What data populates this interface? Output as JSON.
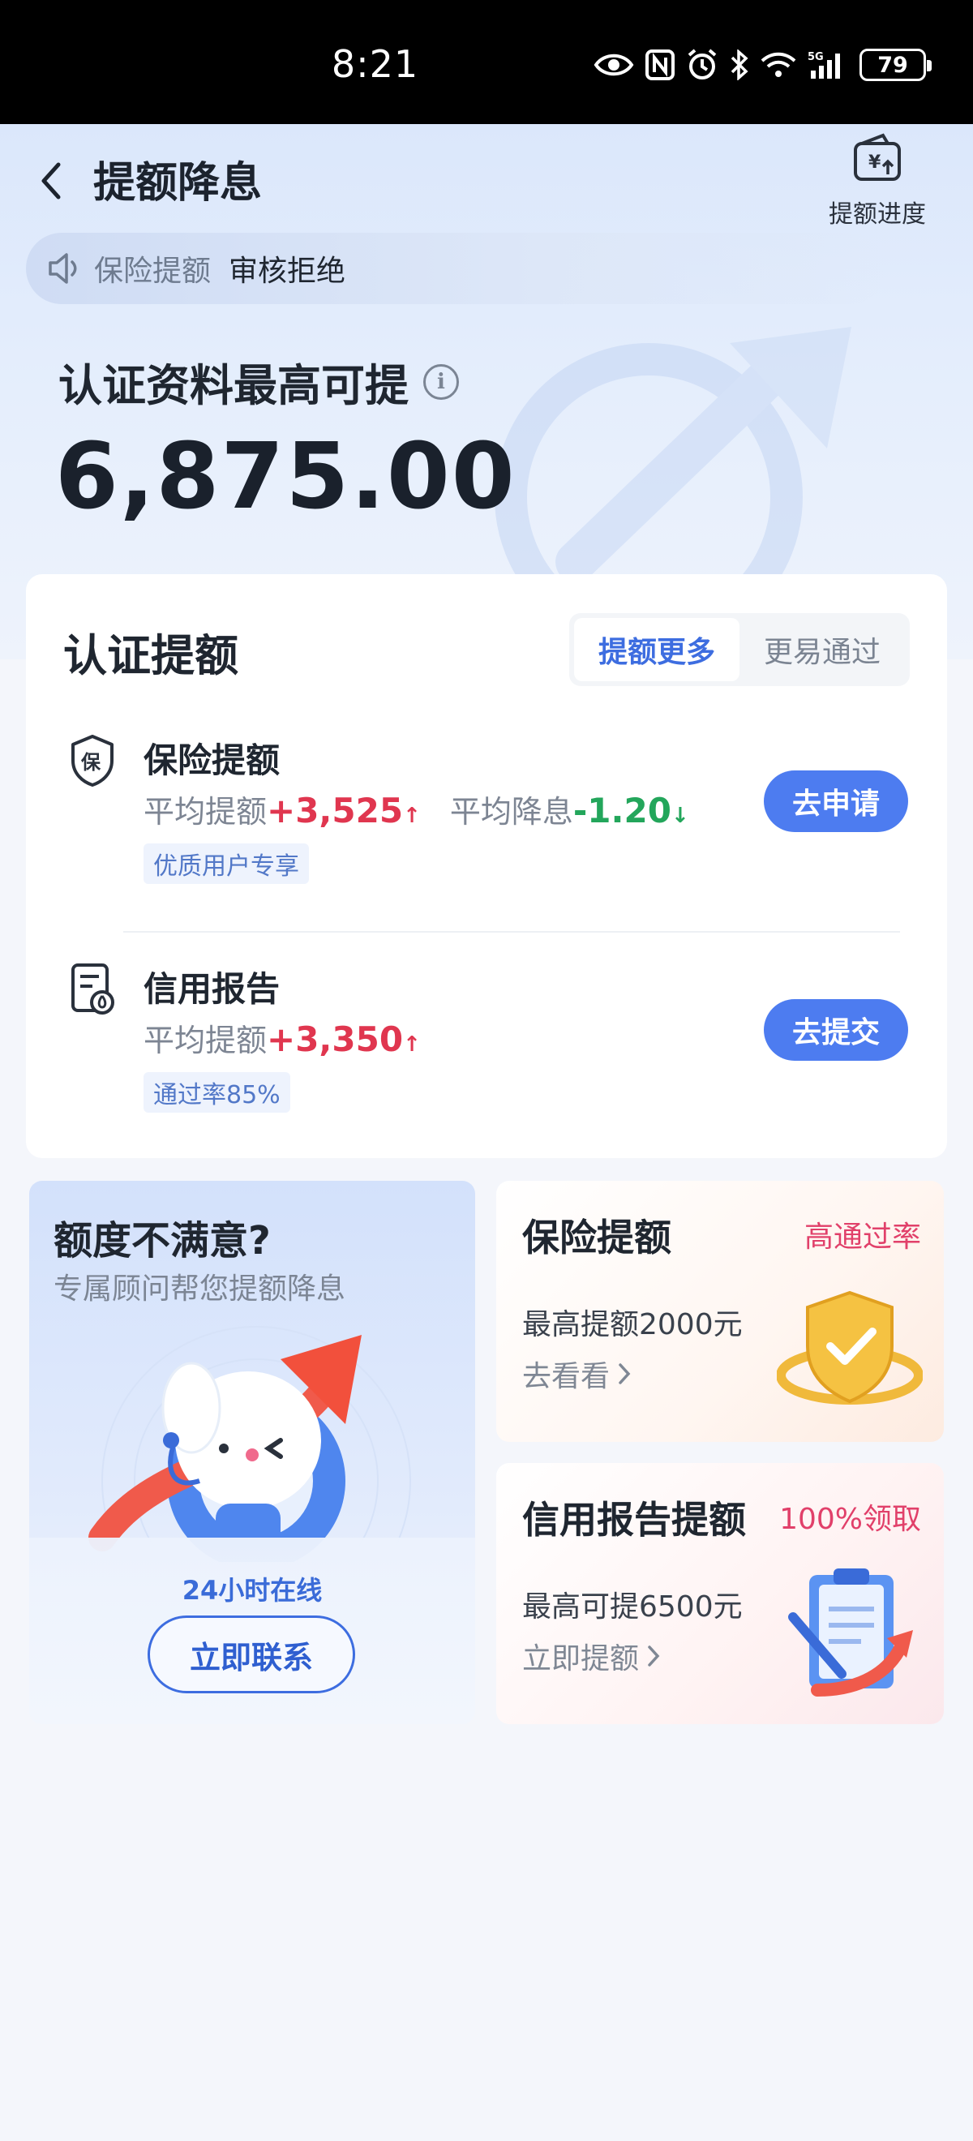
{
  "status_bar": {
    "time": "8:21",
    "battery": "79"
  },
  "header": {
    "title": "提额降息",
    "progress_label": "提额进度"
  },
  "notice": {
    "type": "保险提额",
    "status": "审核拒绝"
  },
  "limit": {
    "label": "认证资料最高可提",
    "amount": "6,875.00"
  },
  "certify": {
    "title": "认证提额",
    "tabs": [
      "提额更多",
      "更易通过"
    ],
    "items": [
      {
        "name": "保险提额",
        "stat1_label": "平均提额",
        "stat1_value": "+3,525",
        "stat1_arrow": "↑",
        "stat2_label": "平均降息",
        "stat2_value": "-1.20",
        "stat2_arrow": "↓",
        "tag": "优质用户专享",
        "action": "去申请"
      },
      {
        "name": "信用报告",
        "stat1_label": "平均提额",
        "stat1_value": "+3,350",
        "stat1_arrow": "↑",
        "tag": "通过率85%",
        "action": "去提交"
      }
    ]
  },
  "advisor": {
    "title": "额度不满意?",
    "subtitle": "专属顾问帮您提额降息",
    "online": "24小时在线",
    "button": "立即联系"
  },
  "cards": [
    {
      "title": "保险提额",
      "badge": "高通过率",
      "desc": "最高提额2000元",
      "link": "去看看"
    },
    {
      "title": "信用报告提额",
      "badge": "100%领取",
      "desc": "最高可提6500元",
      "link": "立即提额"
    }
  ],
  "colors": {
    "accent": "#4d7cf0",
    "increase": "#e0364f",
    "decrease": "#23a65b",
    "badge": "#e1406a"
  },
  "icons": [
    "eye-icon",
    "nfc-icon",
    "alarm-icon",
    "bluetooth-icon",
    "wifi-icon",
    "signal-icon",
    "back-chevron-icon",
    "wallet-icon",
    "speaker-icon",
    "info-icon",
    "shield-icon",
    "document-icon",
    "chevron-right-icon"
  ]
}
